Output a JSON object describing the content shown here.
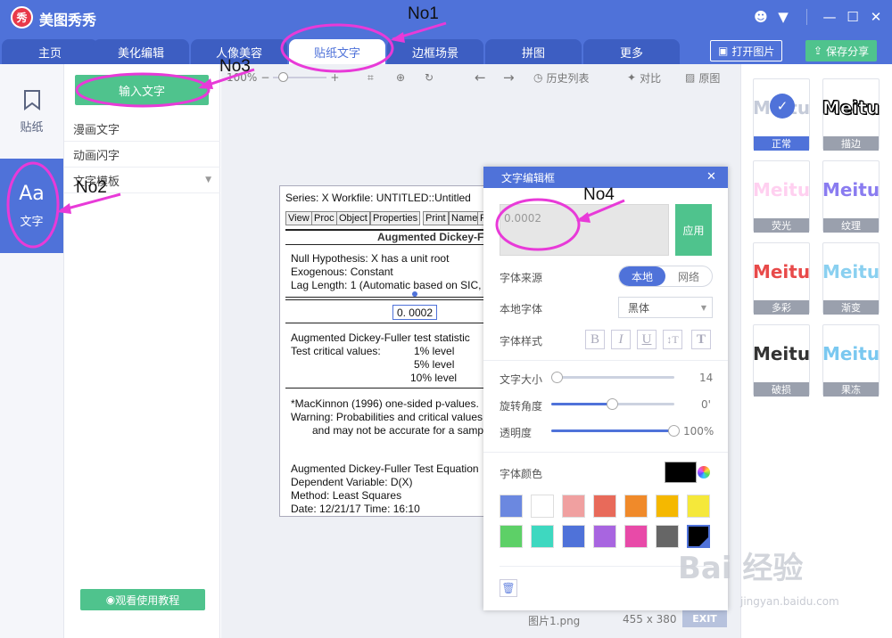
{
  "app": {
    "title": "美图秀秀",
    "logo_char": "秀"
  },
  "window_controls": [
    "chat-icon",
    "menu-icon",
    "minimize-icon",
    "maximize-icon",
    "close-icon"
  ],
  "tabs": [
    {
      "label": "主页"
    },
    {
      "label": "美化编辑"
    },
    {
      "label": "人像美容"
    },
    {
      "label": "贴纸文字",
      "active": true
    },
    {
      "label": "边框场景"
    },
    {
      "label": "拼图"
    },
    {
      "label": "更多"
    }
  ],
  "top_buttons": {
    "open_image": "打开图片",
    "save_share": "保存分享"
  },
  "left_nav": [
    {
      "label": "贴纸",
      "icon": "sticker-icon"
    },
    {
      "label": "文字",
      "icon": "text-aa-icon",
      "icon_text": "Aa",
      "active": true
    }
  ],
  "side_panel": {
    "input_text_button": "输入文字",
    "items": [
      "漫画文字",
      "动画闪字",
      "文字模板"
    ],
    "tutorial_button": "观看使用教程"
  },
  "toolbar": {
    "zoom_label": "100%",
    "history_label": "历史列表",
    "compare_label": "对比",
    "original_label": "原图"
  },
  "image_window": {
    "title": "Series: X    Workfile: UNTITLED::Untitled",
    "buttons": [
      "View",
      "Proc",
      "Object",
      "Properties",
      "Print",
      "Name",
      "F"
    ],
    "header": "Augmented Dickey-Fuller",
    "lines": [
      "Null Hypothesis: X has a unit root",
      "Exogenous: Constant",
      "Lag Length: 1 (Automatic based on SIC,",
      "Augmented Dickey-Fuller test statistic",
      "Test critical values:",
      "1% level",
      "5% level",
      "10% level",
      "*MacKinnon (1996) one-sided p-values.",
      "Warning: Probabilities and critical values",
      "and may not be accurate for a samp",
      "Augmented Dickey-Fuller Test Equation",
      "Dependent Variable: D(X)",
      "Method: Least Squares",
      "Date: 12/21/17   Time: 16:10"
    ],
    "overlay_text": "0. 0002"
  },
  "dialog": {
    "title": "文字编辑框",
    "text_value": "0.0002",
    "apply_button": "应用",
    "font_source_label": "字体来源",
    "font_source_options": [
      "本地",
      "网络"
    ],
    "font_source_selected": "本地",
    "local_font_label": "本地字体",
    "local_font_value": "黑体",
    "font_style_label": "字体样式",
    "font_style_buttons": [
      "B",
      "I",
      "U",
      "↕T",
      "T"
    ],
    "font_size_label": "文字大小",
    "font_size_value": "14",
    "rotation_label": "旋转角度",
    "rotation_value": "0'",
    "opacity_label": "透明度",
    "opacity_value": "100%",
    "color_label": "字体颜色",
    "current_color": "#000000",
    "swatches": [
      "#6b88e0",
      "#ffffff",
      "#f0a0a0",
      "#e86a5a",
      "#f08a2a",
      "#f5b800",
      "#f5e83a",
      "#5dd067",
      "#3ed8c0",
      "#4f72d9",
      "#a865e0",
      "#e84aa8",
      "#666666",
      "#000000"
    ],
    "selected_swatch": 13,
    "sliders": {
      "font_size": 0.03,
      "rotation": 0.5,
      "opacity": 1.0
    }
  },
  "styles": [
    {
      "label": "正常",
      "text": "Meitu",
      "active": true
    },
    {
      "label": "描边",
      "text": "Meitu"
    },
    {
      "label": "荧光",
      "text": "Meitu"
    },
    {
      "label": "纹理",
      "text": "Meitu"
    },
    {
      "label": "多彩",
      "text": "Meitu"
    },
    {
      "label": "渐变",
      "text": "Meitu"
    },
    {
      "label": "破损",
      "text": "Meitu"
    },
    {
      "label": "果冻",
      "text": "Meitu"
    }
  ],
  "status": {
    "filename": "图片1.png",
    "dimensions": "455 x 380",
    "exit_label": "EXIT"
  },
  "annotations": [
    "No1",
    "No2",
    "No3",
    "No4"
  ],
  "watermark": {
    "brand": "Bai 经验",
    "url": "jingyan.baidu.com"
  },
  "accent_color": "#4f72d9",
  "annotation_color": "#e83ad8"
}
